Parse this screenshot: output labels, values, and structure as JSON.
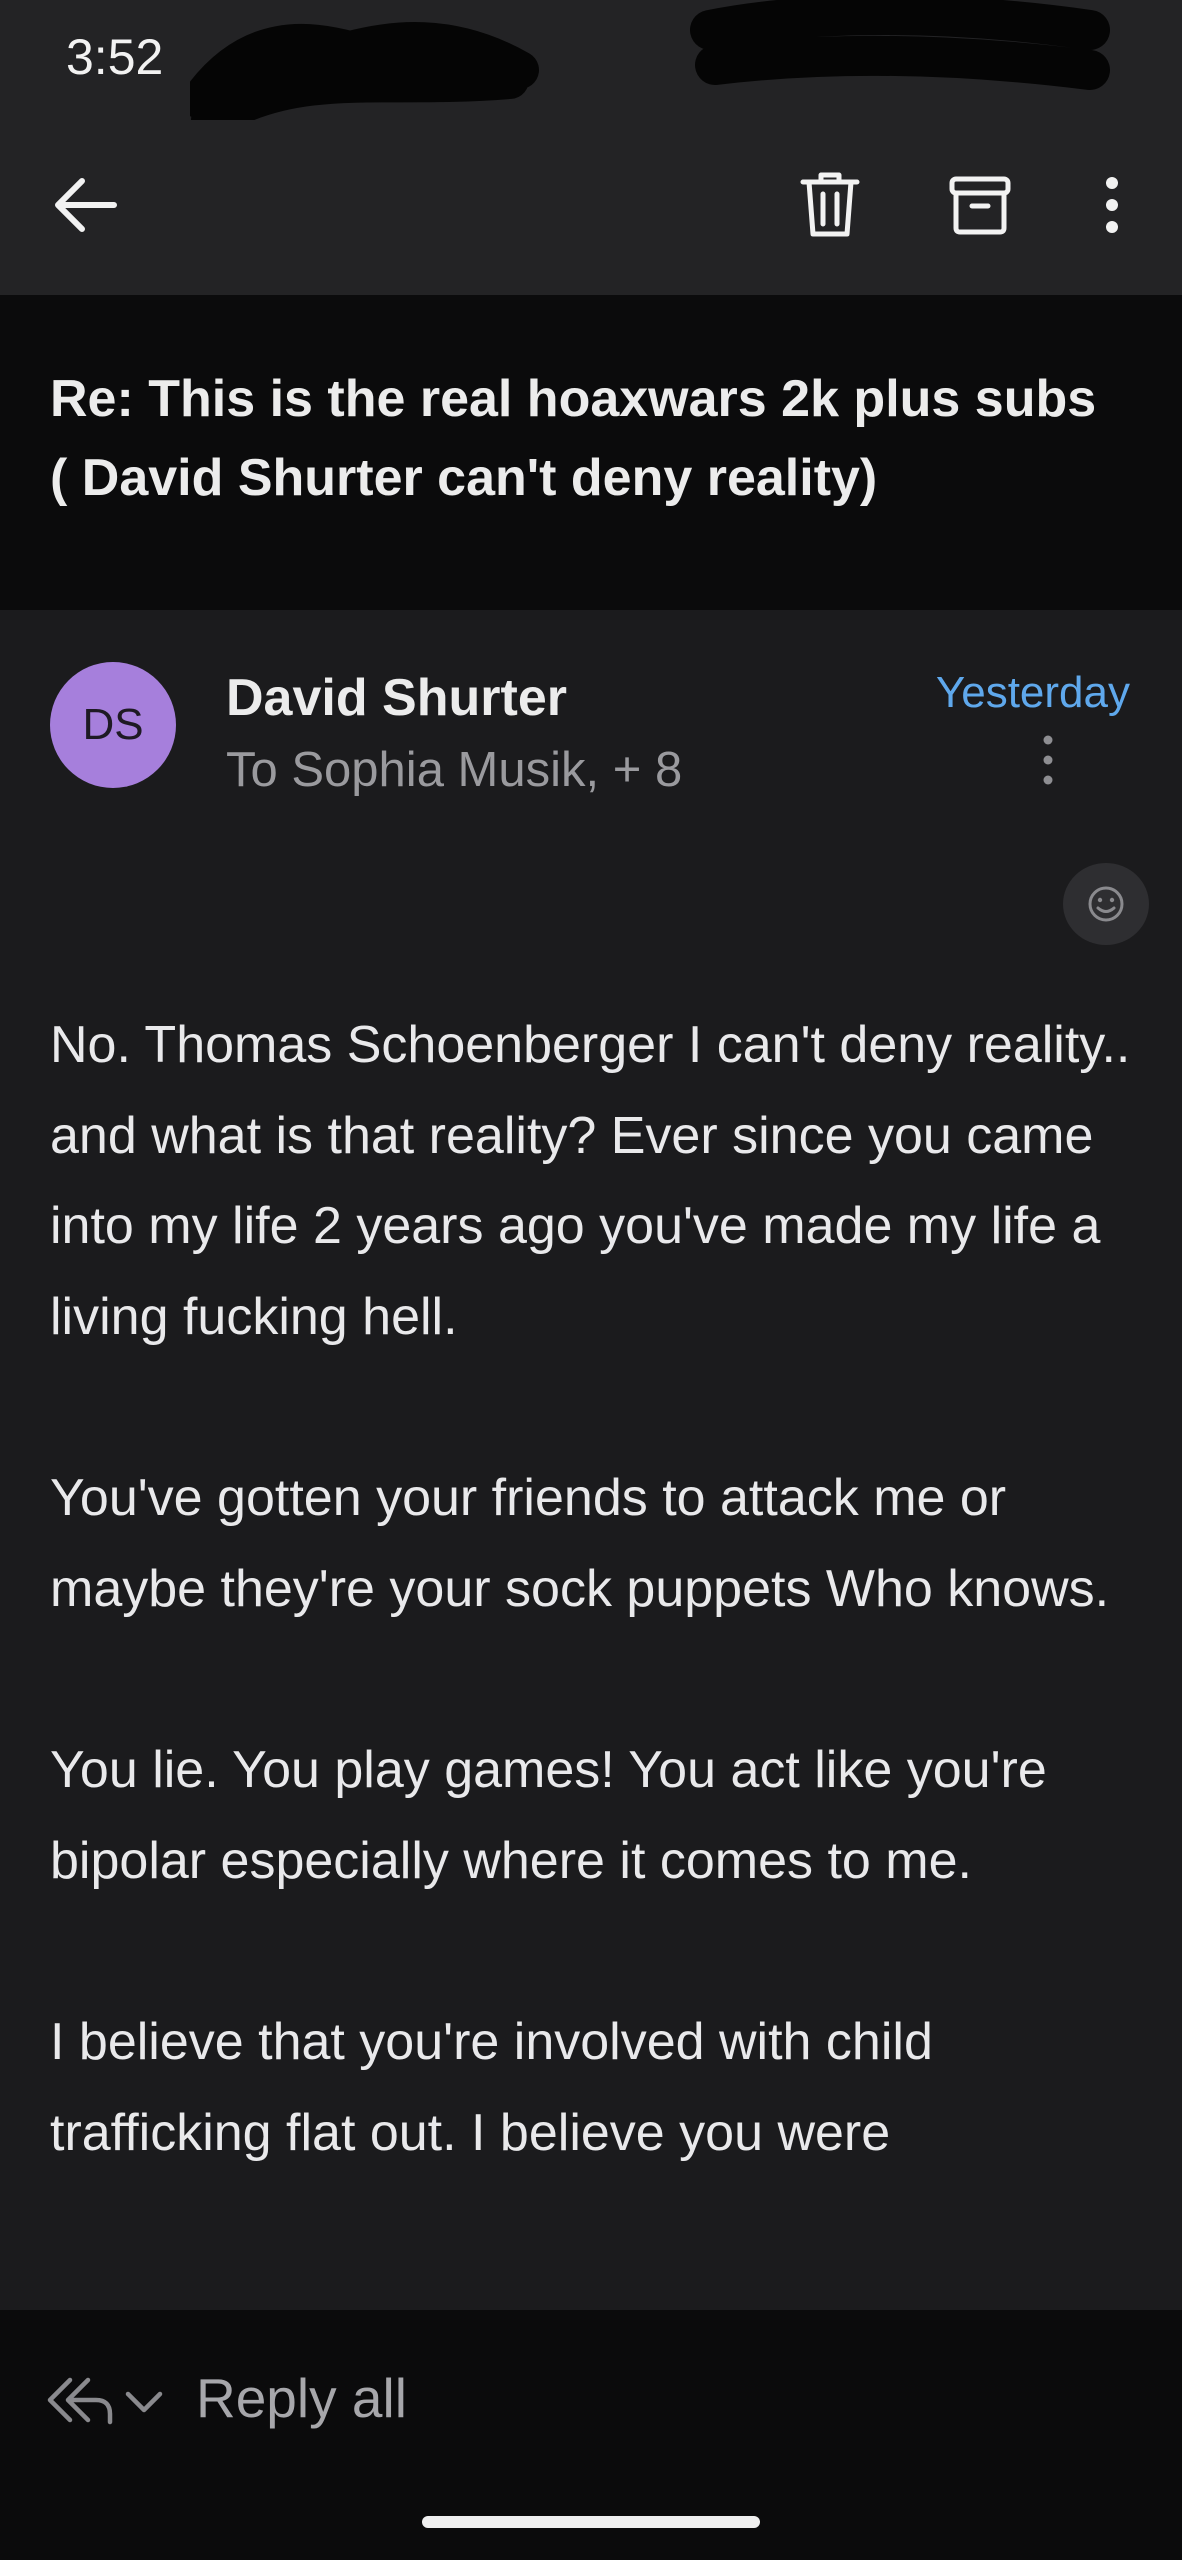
{
  "status_bar": {
    "time": "3:52"
  },
  "toolbar": {
    "back_icon": "arrow-left-icon",
    "delete_icon": "trash-icon",
    "archive_icon": "archive-icon",
    "more_icon": "more-vertical-icon"
  },
  "email": {
    "subject": "Re: This is the real hoaxwars 2k plus subs ( David Shurter can't deny reality)",
    "avatar_initials": "DS",
    "avatar_color": "#a67fdc",
    "sender": "David Shurter",
    "recipients": "To Sophia Musik, + 8",
    "date": "Yesterday",
    "date_color": "#5fa8ec",
    "body": [
      "No. Thomas Schoenberger I can't deny reality.. and what is that reality? Ever since you came into my life 2 years ago you've made my life a living fucking hell.",
      "You've gotten your friends to attack me or maybe they're your sock puppets Who knows.",
      "You lie. You play games! You act like you're bipolar especially where it comes to me.",
      "I believe that you're involved with child trafficking flat out. I believe you were"
    ]
  },
  "bottom_bar": {
    "reply_label": "Reply all"
  }
}
